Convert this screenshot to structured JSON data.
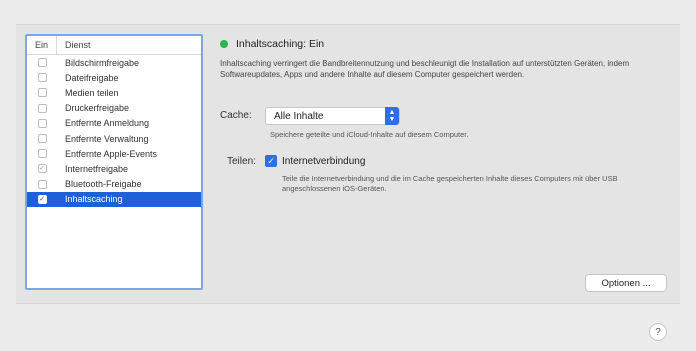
{
  "list": {
    "header_on": "Ein",
    "header_service": "Dienst",
    "items": [
      {
        "label": "Bildschirmfreigabe",
        "checked": false,
        "selected": false
      },
      {
        "label": "Dateifreigabe",
        "checked": false,
        "selected": false
      },
      {
        "label": "Medien teilen",
        "checked": false,
        "selected": false
      },
      {
        "label": "Druckerfreigabe",
        "checked": false,
        "selected": false
      },
      {
        "label": "Entfernte Anmeldung",
        "checked": false,
        "selected": false
      },
      {
        "label": "Entfernte Verwaltung",
        "checked": false,
        "selected": false
      },
      {
        "label": "Entfernte Apple-Events",
        "checked": false,
        "selected": false
      },
      {
        "label": "Internetfreigabe",
        "checked": true,
        "selected": false
      },
      {
        "label": "Bluetooth-Freigabe",
        "checked": false,
        "selected": false
      },
      {
        "label": "Inhaltscaching",
        "checked": true,
        "selected": true
      }
    ]
  },
  "detail": {
    "status_title": "Inhaltscaching: Ein",
    "description": "Inhaltscaching verringert die Bandbreitennutzung und beschleunigt die Installation auf unterstützten Geräten, indem Softwareupdates, Apps und andere Inhalte auf diesem Computer gespeichert werden.",
    "cache_label": "Cache:",
    "cache_value": "Alle Inhalte",
    "cache_help": "Speichere geteilte und iCloud-Inhalte auf diesem Computer.",
    "share_label": "Teilen:",
    "share_option": "Internetverbindung",
    "share_checked": true,
    "share_desc": "Teile die Internetverbindung und die im Cache gespeicherten Inhalte dieses Computers mit über USB angeschlossenen iOS-Geräten.",
    "options_button": "Optionen ...",
    "help_button": "?"
  },
  "colors": {
    "status_dot": "#2fb24c",
    "accent": "#2f6fe4",
    "selection": "#1f5fd8"
  }
}
